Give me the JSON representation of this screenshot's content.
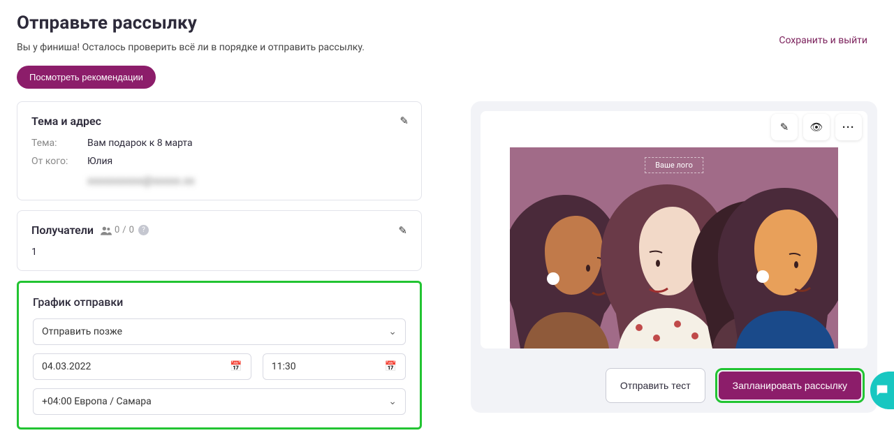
{
  "header": {
    "title": "Отправьте рассылку",
    "subtitle": "Вы у финиша! Осталось проверить всё ли в порядке и отправить рассылку.",
    "save_exit": "Сохранить и выйти",
    "recommendations_btn": "Посмотреть рекомендации"
  },
  "topic_card": {
    "title": "Тема и адрес",
    "subject_label": "Тема:",
    "subject_value": "Вам подарок к 8 марта",
    "from_label": "От кого:",
    "from_name": "Юлия",
    "from_email_masked": "xxxxxxxxxx@xxxxx.xx"
  },
  "recipients_card": {
    "title": "Получатели",
    "count_current": "0",
    "count_total": "0",
    "list_value": "1"
  },
  "schedule_card": {
    "title": "График отправки",
    "mode": "Отправить позже",
    "date": "04.03.2022",
    "time": "11:30",
    "timezone": "+04:00 Европа / Самара"
  },
  "preview": {
    "logo_placeholder": "Ваше лого"
  },
  "actions": {
    "send_test": "Отправить тест",
    "schedule_send": "Запланировать рассылку"
  }
}
